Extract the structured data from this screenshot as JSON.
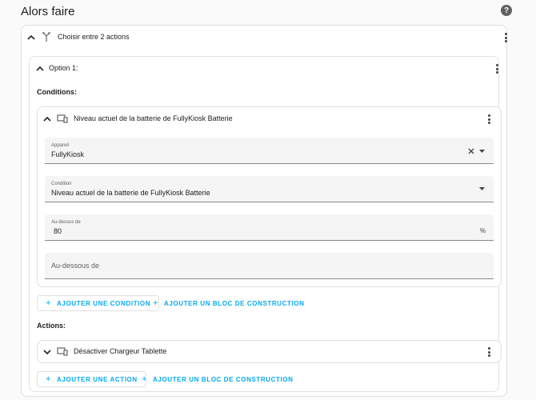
{
  "page": {
    "title": "Alors faire"
  },
  "choose_block": {
    "title": "Choisir entre 2 actions"
  },
  "option": {
    "title": "Option 1:"
  },
  "conditions": {
    "label": "Conditions:",
    "condition_card": {
      "title": "Niveau actuel de la batterie de FullyKiosk Batterie",
      "fields": {
        "device": {
          "label": "Appareil",
          "value": "FullyKiosk"
        },
        "condition": {
          "label": "Condition",
          "value": "Niveau actuel de la batterie de FullyKiosk Batterie"
        },
        "above": {
          "label": "Au-dessus de",
          "value": "80",
          "unit": "%"
        },
        "below": {
          "placeholder": "Au-dessous de"
        }
      }
    },
    "add_condition_label": "AJOUTER UNE CONDITION",
    "add_block_label": "AJOUTER UN BLOC DE CONSTRUCTION"
  },
  "actions": {
    "label": "Actions:",
    "action_card": {
      "title": "Désactiver Chargeur Tablette"
    },
    "add_action_label": "AJOUTER UNE ACTION",
    "add_block_label": "AJOUTER UN BLOC DE CONSTRUCTION"
  },
  "icons": {
    "help": "help-circle-icon",
    "chevron": "chevron-icon",
    "choose": "arrow-decision-icon",
    "device": "device-icon",
    "menu": "dots-vertical-icon",
    "clear": "close-icon",
    "dropdown": "menu-down-icon",
    "plus": "plus-icon"
  },
  "colors": {
    "accent": "#03a9f4",
    "text": "#212121",
    "secondary_text": "#616161",
    "border": "#e0e0e0"
  }
}
